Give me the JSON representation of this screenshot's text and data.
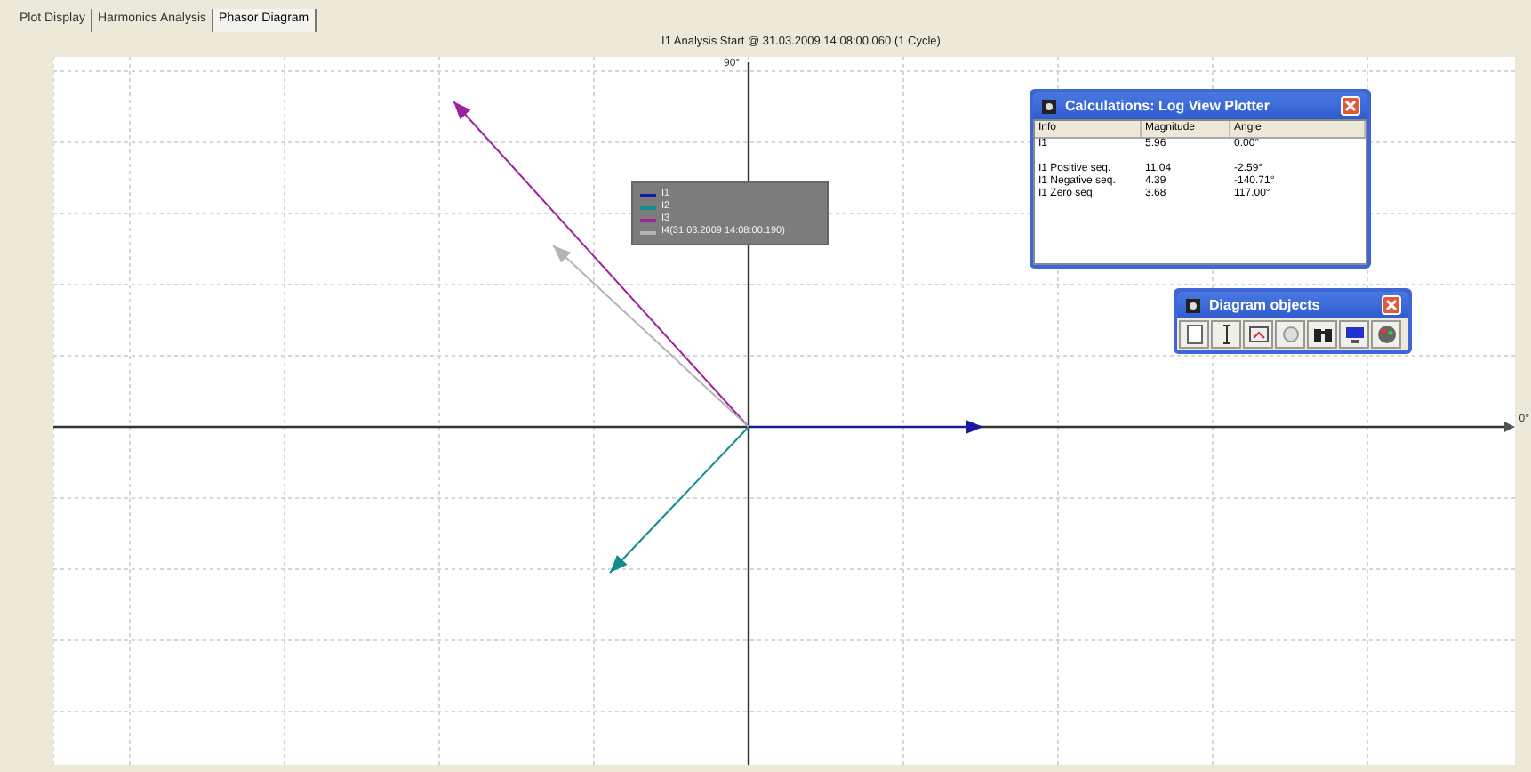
{
  "tabs": [
    {
      "label": "Plot Display",
      "selected": false
    },
    {
      "label": "Harmonics Analysis",
      "selected": false
    },
    {
      "label": "Phasor Diagram",
      "selected": true
    }
  ],
  "plot": {
    "title": "I1 Analysis Start @ 31.03.2009 14:08:00.060 (1 Cycle)",
    "axis_top": "90°",
    "axis_right": "0°",
    "legend": [
      {
        "label": "I1",
        "color": "#1a1aa0"
      },
      {
        "label": "I2",
        "color": "#138c8c"
      },
      {
        "label": "I3",
        "color": "#a020a0"
      },
      {
        "label": "I4(31.03.2009 14:08:00.190)",
        "color": "#b4b4b4"
      }
    ]
  },
  "calc_window": {
    "title": "Calculations: Log View Plotter",
    "columns": [
      "Info",
      "Magnitude",
      "Angle"
    ],
    "rows": [
      [
        "I1",
        "5.96",
        "0.00°"
      ],
      [
        "I1 Positive seq.",
        "11.04",
        "-2.59°"
      ],
      [
        "I1 Negative seq.",
        "4.39",
        "-140.71°"
      ],
      [
        "I1 Zero seq.",
        "3.68",
        "117.00°"
      ]
    ]
  },
  "objects_window": {
    "title": "Diagram objects"
  }
}
